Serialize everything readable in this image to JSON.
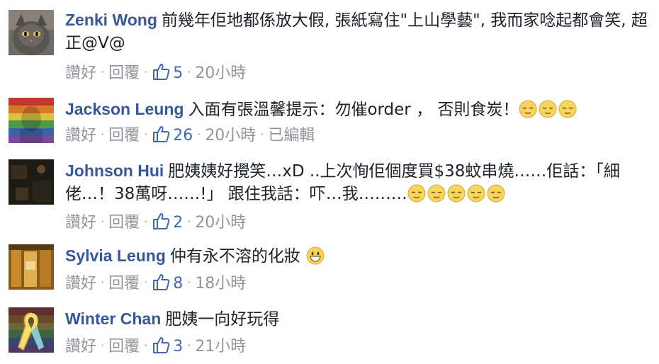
{
  "comments": [
    {
      "name": "Zenki Wong",
      "text": "前幾年佢地都係放大假, 張紙寫住\"上山學藝\", 我而家唸起都會笑, 超正@V@",
      "reply_label": "讚好",
      "reply2_label": "回覆",
      "likes": "5",
      "time": "20小時",
      "edited": "",
      "emojis": 0,
      "avatar": "cat-avatar"
    },
    {
      "name": "Jackson Leung",
      "text": "入面有張溫馨提示：勿催order ， 否則食炭！",
      "reply_label": "讚好",
      "reply2_label": "回覆",
      "likes": "26",
      "time": "20小時",
      "edited": "已編輯",
      "emojis": 3,
      "avatar": "rainbow-avatar"
    },
    {
      "name": "Johnson Hui",
      "text": "肥姨姨好攪笑…xD ..上次恂佢個度買$38蚊串燒……佢話：「細佬…！38萬呀……!」 跟住我話：吓…我………",
      "reply_label": "讚好",
      "reply2_label": "回覆",
      "likes": "2",
      "time": "20小時",
      "edited": "",
      "emojis": 5,
      "avatar": "dark-avatar"
    },
    {
      "name": "Sylvia Leung",
      "text": "仲有永不溶的化妝",
      "reply_label": "讚好",
      "reply2_label": "回覆",
      "likes": "8",
      "time": "18小時",
      "edited": "",
      "emojis": 1,
      "avatar": "bottles-avatar"
    },
    {
      "name": "Winter Chan",
      "text": "肥姨一向好玩得",
      "reply_label": "讚好",
      "reply2_label": "回覆",
      "likes": "3",
      "time": "21小時",
      "edited": "",
      "emojis": 0,
      "avatar": "ribbon-avatar"
    }
  ],
  "colors": {
    "name": "#365899",
    "meta": "#90949c",
    "text": "#1d2129"
  }
}
